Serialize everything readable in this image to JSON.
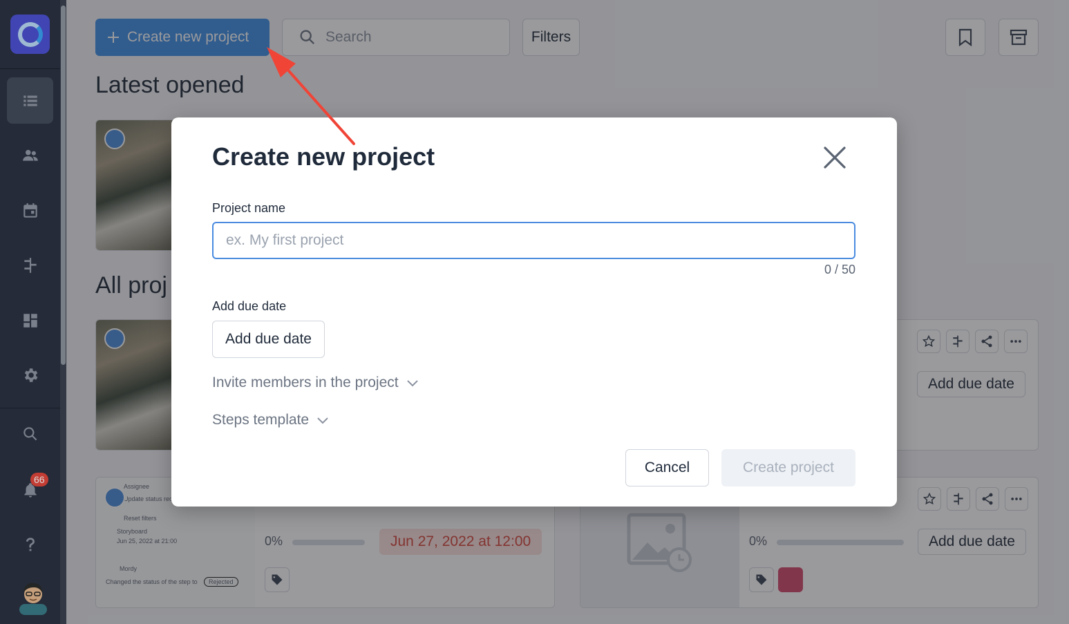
{
  "app": {
    "notification_count": "66"
  },
  "toolbar": {
    "create_label": "Create new project",
    "search_placeholder": "Search",
    "filters_label": "Filters"
  },
  "sections": {
    "latest": "Latest opened",
    "all": "All proj"
  },
  "cards": [
    {
      "progress": "0%",
      "due_date": "Jun 27, 2022 at 12:00",
      "preview_lines": [
        "Assignee",
        "Update status req",
        "Reset filters",
        "Storyboard",
        "Jun 25, 2022 at 21:00",
        "Mordy",
        "Changed the status of the step to",
        "Rejected"
      ]
    },
    {
      "progress": "0%",
      "due_label": "Add due date"
    },
    {
      "due_label": "Add due date"
    }
  ],
  "modal": {
    "title": "Create new project",
    "name_label": "Project name",
    "name_placeholder": "ex. My first project",
    "name_value": "",
    "counter": "0 / 50",
    "due_label": "Add due date",
    "due_button": "Add due date",
    "invite_label": "Invite members in the project",
    "steps_label": "Steps template",
    "cancel_label": "Cancel",
    "submit_label": "Create project"
  },
  "colors": {
    "primary": "#3f8fe6",
    "sidebar": "#2b3140",
    "annotation_arrow": "#f04437",
    "due_overdue_bg": "#fbe0de",
    "due_overdue_text": "#d5473d",
    "tag_color": "#d44a6e"
  },
  "icons": {
    "sidebar": [
      "logo-icon",
      "list-icon",
      "users-icon",
      "calendar-icon",
      "steps-icon",
      "dashboard-icon",
      "gear-icon",
      "search-icon",
      "bell-icon",
      "help-icon"
    ]
  }
}
